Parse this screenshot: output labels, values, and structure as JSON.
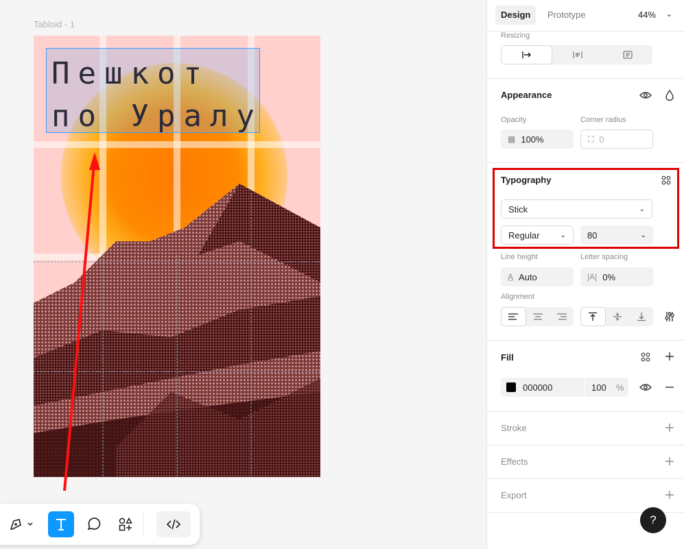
{
  "canvas": {
    "frame_label": "Tabloid - 1",
    "text_line_1": "Пешкот",
    "text_line_2": "по Уралу"
  },
  "toolbar": {
    "tools": [
      "pen-icon",
      "chevron-down-icon",
      "text-icon",
      "comment-icon",
      "shapes-icon",
      "code-icon"
    ],
    "accent": "#0d99ff"
  },
  "panel": {
    "tabs": {
      "design": "Design",
      "prototype": "Prototype"
    },
    "zoom": "44%",
    "resizing": {
      "label": "Resizing"
    },
    "appearance": {
      "title": "Appearance",
      "opacity_label": "Opacity",
      "opacity_value": "100%",
      "radius_label": "Corner radius",
      "radius_value": "0"
    },
    "typography": {
      "title": "Typography",
      "font": "Stick",
      "weight": "Regular",
      "size": "80",
      "line_height_label": "Line height",
      "line_height_value": "Auto",
      "letter_spacing_label": "Letter spacing",
      "letter_spacing_value": "0%",
      "alignment_label": "Alignment",
      "highlight_color": "#e00000"
    },
    "fill": {
      "title": "Fill",
      "hex": "000000",
      "opacity": "100",
      "percent": "%"
    },
    "stroke": {
      "title": "Stroke"
    },
    "effects": {
      "title": "Effects"
    },
    "export": {
      "title": "Export"
    },
    "help": "?"
  }
}
